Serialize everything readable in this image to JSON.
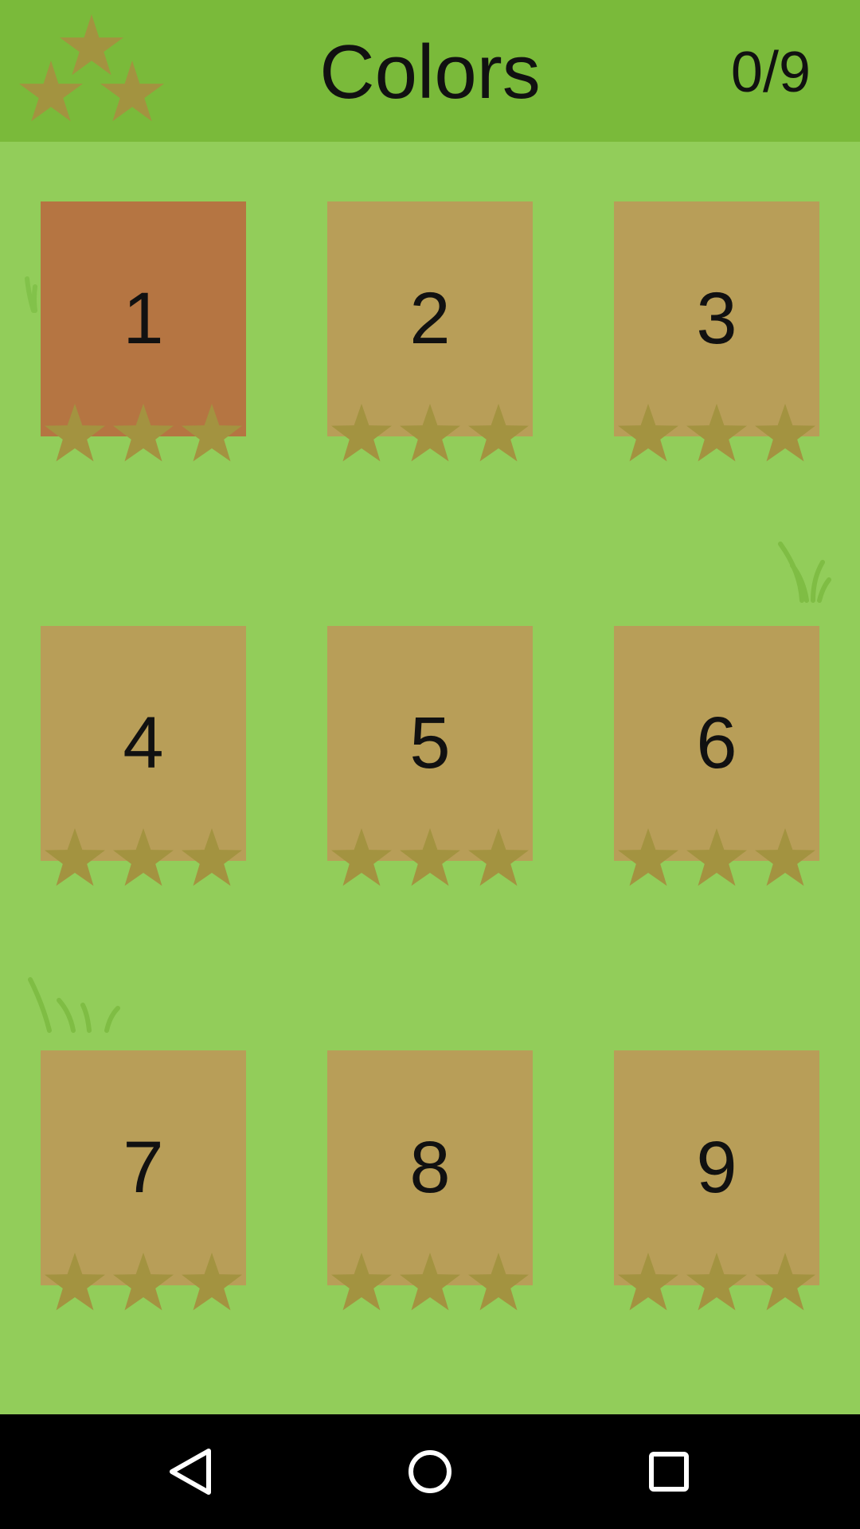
{
  "header": {
    "title": "Colors",
    "progress": "0/9",
    "icon": "three-stars-icon"
  },
  "levels": [
    {
      "number": "1",
      "state": "unlocked",
      "stars_earned": 0
    },
    {
      "number": "2",
      "state": "locked",
      "stars_earned": 0
    },
    {
      "number": "3",
      "state": "locked",
      "stars_earned": 0
    },
    {
      "number": "4",
      "state": "locked",
      "stars_earned": 0
    },
    {
      "number": "5",
      "state": "locked",
      "stars_earned": 0
    },
    {
      "number": "6",
      "state": "locked",
      "stars_earned": 0
    },
    {
      "number": "7",
      "state": "locked",
      "stars_earned": 0
    },
    {
      "number": "8",
      "state": "locked",
      "stars_earned": 0
    },
    {
      "number": "9",
      "state": "locked",
      "stars_earned": 0
    }
  ],
  "stars_per_level": 3,
  "colors": {
    "background": "#92cd5a",
    "header": "#7aba3a",
    "card_locked": "#b89e58",
    "card_unlocked": "#b57542",
    "star": "#a39340",
    "grass": "#6fad36"
  },
  "navbar": {
    "back_icon": "back-triangle-icon",
    "home_icon": "home-circle-icon",
    "recents_icon": "recents-square-icon"
  }
}
